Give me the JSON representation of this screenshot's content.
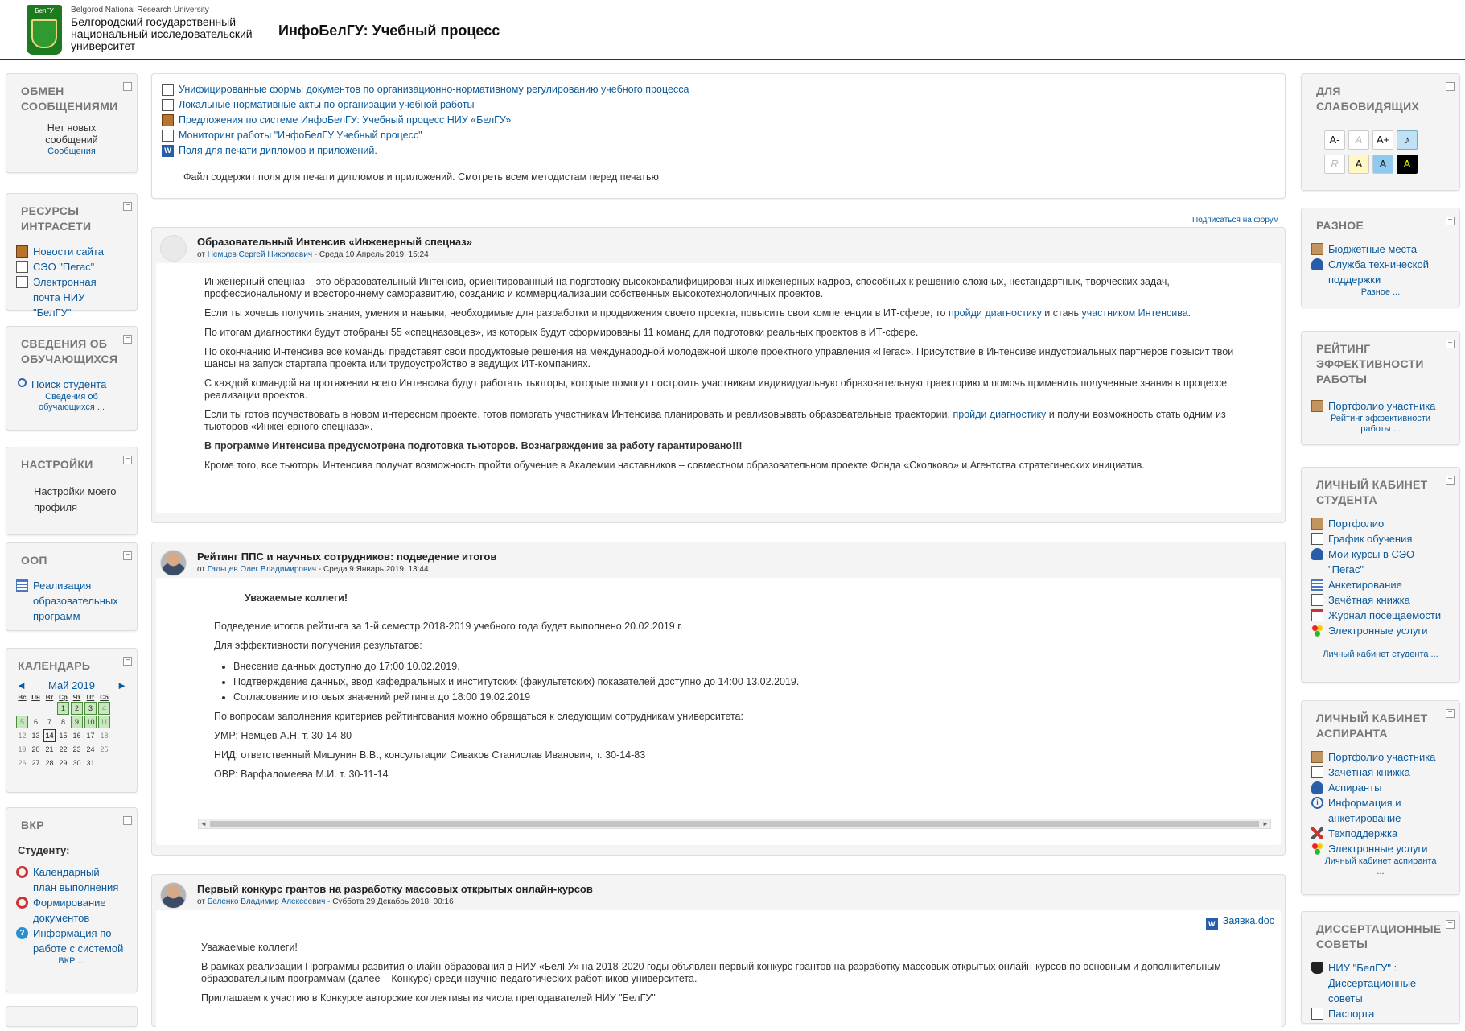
{
  "colors": {
    "link": "#0a5a9c",
    "block_bg": "#f4f4f4",
    "logo_green": "#1e7a1e"
  },
  "header": {
    "logo_text": "БелГУ",
    "univ_en": "Belgorod National Research University",
    "univ_ru_1": "Белгородский государственный",
    "univ_ru_2": "национальный исследовательский",
    "univ_ru_3": "университет",
    "site_title": "ИнфоБелГУ: Учебный процесс"
  },
  "left": {
    "messages": {
      "title": "Обмен сообщениями",
      "text": "Нет новых сообщений",
      "link": "Сообщения"
    },
    "resources": {
      "title": "Ресурсы интрасети",
      "items": [
        {
          "icon": "news-icon",
          "label": "Новости сайта"
        },
        {
          "icon": "document-icon",
          "label": "СЭО \"Пегас\""
        },
        {
          "icon": "document-icon",
          "label": "Электронная почта НИУ \"БелГУ\""
        }
      ]
    },
    "students": {
      "title": "Сведения об обучающихся",
      "search": "Поиск студента",
      "more": "Сведения об обучающихся ..."
    },
    "settings": {
      "title": "Настройки",
      "item": "Настройки моего профиля"
    },
    "oop": {
      "title": "ООП",
      "item": "Реализация образовательных программ"
    },
    "calendar": {
      "title": "Календарь",
      "month": "Май 2019",
      "prev": "◄",
      "next": "►",
      "weekdays": [
        "Вс",
        "Пн",
        "Вт",
        "Ср",
        "Чт",
        "Пт",
        "Сб"
      ],
      "weeks": [
        [
          "",
          "",
          "",
          "1",
          "2",
          "3",
          "4"
        ],
        [
          "5",
          "6",
          "7",
          "8",
          "9",
          "10",
          "11"
        ],
        [
          "12",
          "13",
          "14",
          "15",
          "16",
          "17",
          "18"
        ],
        [
          "19",
          "20",
          "21",
          "22",
          "23",
          "24",
          "25"
        ],
        [
          "26",
          "27",
          "28",
          "29",
          "30",
          "31",
          ""
        ]
      ],
      "event_days": [
        "1",
        "2",
        "3",
        "4",
        "5",
        "9",
        "10",
        "11"
      ],
      "today": "14"
    },
    "vkr": {
      "title": "ВКР",
      "subtitle": "Студенту:",
      "items": [
        {
          "icon": "round-red-icon",
          "label": "Календарный план выполнения"
        },
        {
          "icon": "round-red-icon",
          "label": "Формирование документов"
        },
        {
          "icon": "help-icon",
          "label": "Информация по работе с системой"
        }
      ],
      "more": "ВКР ..."
    }
  },
  "main": {
    "top_links": [
      "Унифицированные формы документов по организационно-нормативному регулированию учебного процесса",
      "Локальные нормативные акты по организации учебной работы",
      "Предложения по системе ИнфоБелГУ: Учебный процесс НИУ «БелГУ»",
      "Мониторинг работы \"ИнфоБелГУ:Учебный процесс\"",
      "Поля для печати дипломов и приложений."
    ],
    "top_note": "Файл содержит поля для печати дипломов и приложений. Смотреть всем методистам перед печатью",
    "subscribe": "Подписаться на форум",
    "post1": {
      "title": "Образовательный Интенсив «Инженерный спецназ»",
      "meta_prefix": "от ",
      "author": "Немцев Сергей Николаевич",
      "meta_suffix": " - Среда 10 Апрель 2019, 15:24",
      "p1": "Инженерный спецназ – это образовательный Интенсив, ориентированный на подготовку высококвалифицированных инженерных кадров, способных к решению сложных, нестандартных, творческих задач, профессиональному и всестороннему саморазвитию, созданию и коммерциализации собственных высокотехнологичных проектов.",
      "p2a": "Если ты хочешь получить знания, умения и навыки, необходимые для разработки и продвижения своего проекта, повысить свои компетенции в ИТ-сфере, то ",
      "p2link1": "пройди диагностику",
      "p2b": " и стань ",
      "p2link2": "участником Интенсива",
      "p2c": ".",
      "p3": "По итогам диагностики будут отобраны 55 «спецназовцев», из которых будут сформированы 11 команд для подготовки реальных проектов в ИТ-сфере.",
      "p4": "По окончанию Интенсива все команды представят свои продуктовые решения на международной молодежной школе проектного управления «Пегас». Присутствие в Интенсиве индустриальных партнеров повысит твои шансы на запуск стартапа проекта или трудоустройство в ведущих ИТ-компаниях.",
      "p5": "С каждой командой на протяжении всего Интенсива будут работать тьюторы, которые помогут построить участникам индивидуальную образовательную траекторию и помочь применить полученные знания в процессе реализации проектов.",
      "p6a": "Если ты готов поучаствовать в новом интересном проекте, готов помогать участникам Интенсива планировать и реализовывать образовательные траектории, ",
      "p6link": "пройди диагностику",
      "p6b": " и получи возможность стать одним из тьюторов «Инженерного спецназа».",
      "p7": "В программе Интенсива предусмотрена подготовка тьюторов. Вознаграждение за работу гарантировано!!!",
      "p8": "Кроме того, все тьюторы Интенсива получат возможность пройти обучение в Академии наставников – совместном образовательном проекте Фонда «Сколково» и Агентства стратегических инициатив."
    },
    "post2": {
      "title": "Рейтинг ППС и научных сотрудников: подведение итогов",
      "meta_prefix": "от ",
      "author": "Гальцев Олег Владимирович",
      "meta_suffix": " - Среда 9 Январь 2019, 13:44",
      "greeting": "Уважаемые коллеги!",
      "p1": "Подведение итогов рейтинга за 1-й семестр 2018-2019 учебного года будет выполнено 20.02.2019 г.",
      "p2": "Для эффективности получения результатов:",
      "list": [
        "Внесение данных доступно до 17:00 10.02.2019.",
        "Подтверждение данных, ввод кафедральных и институтских (факультетских) показателей доступно до 14:00 13.02.2019.",
        "Согласование итоговых значений рейтинга до 18:00 19.02.2019"
      ],
      "p3": "По вопросам заполнения критериев рейтингования можно обращаться к следующим сотрудникам университета:",
      "p4": "УМР: Немцев А.Н. т. 30-14-80",
      "p5": "НИД: ответственный Мишунин В.В., консультации Сиваков Станислав Иванович, т. 30-14-83",
      "p6": "ОВР: Варфаломеева М.И. т. 30-11-14"
    },
    "post3": {
      "title": "Первый конкурс грантов на разработку массовых открытых онлайн-курсов",
      "meta_prefix": "от ",
      "author": "Беленко Владимир Алексеевич",
      "meta_suffix": " - Суббота 29 Декабрь 2018, 00:16",
      "attachment": "Заявка.doc",
      "greeting": "Уважаемые коллеги!",
      "p1": "В рамках реализации Программы развития онлайн-образования в НИУ «БелГУ» на 2018-2020 годы объявлен первый конкурс грантов на разработку массовых открытых онлайн-курсов по основным и дополнительным образовательным программам (далее – Конкурс) среди научно-педагогических работников университета.",
      "p2": "Приглашаем к участию в Конкурсе авторские коллективы из числа преподавателей НИУ \"БелГУ\""
    }
  },
  "right": {
    "a11y": {
      "title": "Для слабовидящих",
      "btn_minus": "A-",
      "btn_normal": "A",
      "btn_plus": "A+",
      "btn_r": "R",
      "btn_a1": "A",
      "btn_a2": "A",
      "btn_a3": "A"
    },
    "misc": {
      "title": "Разное",
      "items": [
        {
          "icon": "book-icon",
          "label": "Бюджетные места"
        },
        {
          "icon": "user-icon",
          "label": "Служба технической поддержки"
        }
      ],
      "more": "Разное ..."
    },
    "rating": {
      "title": "Рейтинг эффективности работы",
      "item": "Портфолио участника",
      "more": "Рейтинг эффективности работы ..."
    },
    "student_cab": {
      "title": "Личный кабинет студента",
      "items": [
        {
          "icon": "book-icon",
          "label": "Портфолио"
        },
        {
          "icon": "document-icon",
          "label": "График обучения"
        },
        {
          "icon": "user-icon",
          "label": "Мои курсы в СЭО \"Пегас\""
        },
        {
          "icon": "list-icon",
          "label": "Анкетирование"
        },
        {
          "icon": "document-icon",
          "label": "Зачётная книжка"
        },
        {
          "icon": "calendar-icon",
          "label": "Журнал посещаемости"
        },
        {
          "icon": "traffic-icon",
          "label": "Электронные услуги"
        }
      ],
      "more": "Личный кабинет студента ..."
    },
    "grad_cab": {
      "title": "Личный кабинет аспиранта",
      "items": [
        {
          "icon": "book-icon",
          "label": "Портфолио участника"
        },
        {
          "icon": "document-icon",
          "label": "Зачётная книжка"
        },
        {
          "icon": "user-icon",
          "label": "Аспиранты"
        },
        {
          "icon": "info-icon",
          "label": "Информация и анкетирование"
        },
        {
          "icon": "tools-icon",
          "label": "Техподдержка"
        },
        {
          "icon": "traffic-icon",
          "label": "Электронные услуги"
        }
      ],
      "more": "Личный кабинет аспиранта ..."
    },
    "dissertation": {
      "title": "Диссертационные советы",
      "items": [
        {
          "icon": "cap-icon",
          "label": "НИУ \"БелГУ\" : Диссертационные советы"
        },
        {
          "icon": "document-icon",
          "label": "Паспорта"
        }
      ]
    }
  }
}
